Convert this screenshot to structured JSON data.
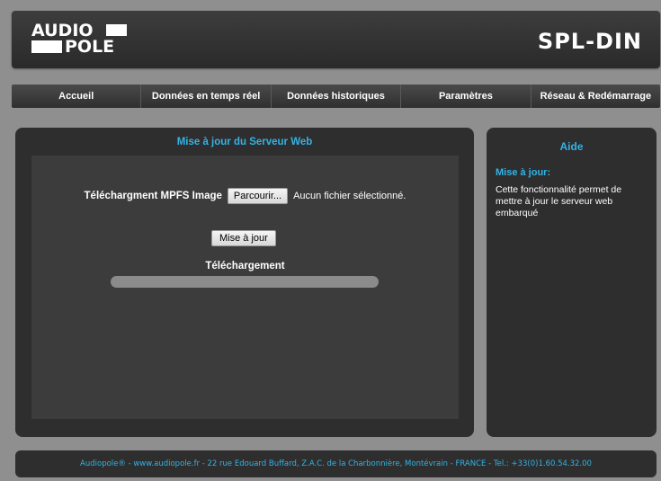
{
  "header": {
    "logo_top": "AUDIO",
    "logo_bottom": "POLE",
    "product": "SPL-DIN"
  },
  "nav": {
    "items": [
      {
        "label": "Accueil"
      },
      {
        "label": "Données en temps réel"
      },
      {
        "label": "Données historiques"
      },
      {
        "label": "Paramètres"
      },
      {
        "label": "Réseau & Redémarrage"
      }
    ]
  },
  "main": {
    "title": "Mise à jour du Serveur Web",
    "upload_label": "Téléchargment MPFS Image",
    "browse_button": "Parcourir...",
    "file_status": "Aucun fichier sélectionné.",
    "update_button": "Mise à jour",
    "progress_label": "Téléchargement",
    "progress_value": 0
  },
  "help": {
    "title": "Aide",
    "subtitle": "Mise à jour:",
    "text": "Cette fonctionnalité permet de mettre à jour le serveur web embarqué"
  },
  "footer": {
    "text": "Audiopole® - www.audiopole.fr - 22 rue Edouard Buffard, Z.A.C. de la Charbonnière, Montévrain - FRANCE - Tel.: +33(0)1.60.54.32.00"
  },
  "colors": {
    "accent": "#33b3e6",
    "panel": "#2e2e2e",
    "background": "#8f8f8f"
  }
}
